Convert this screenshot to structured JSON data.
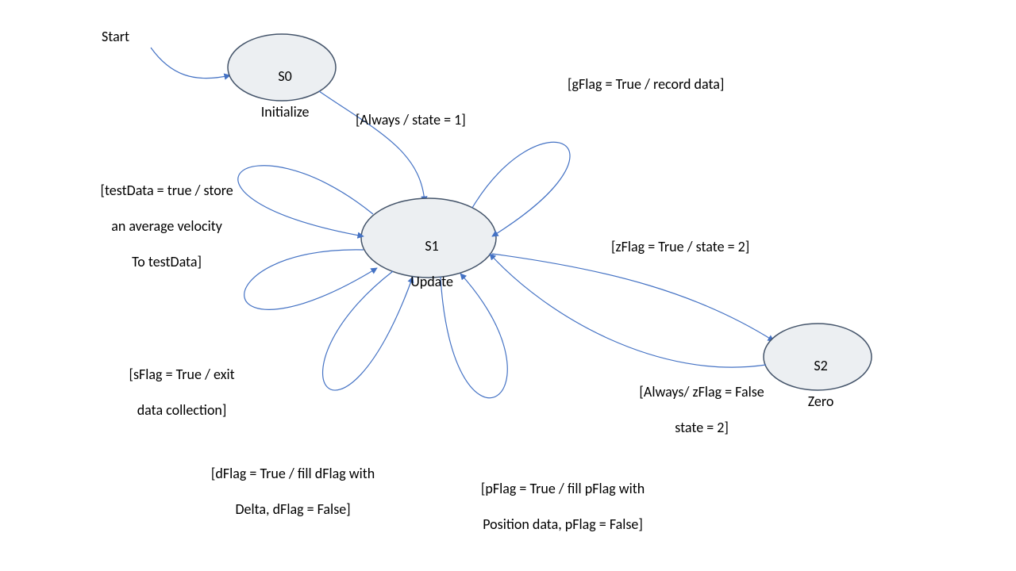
{
  "start_label": "Start",
  "states": {
    "s0": {
      "id": "S0",
      "name": "Initialize"
    },
    "s1": {
      "id": "S1",
      "name": "Update"
    },
    "s2": {
      "id": "S2",
      "name": "Zero"
    }
  },
  "transitions": {
    "s0_to_s1": "[Always / state = 1]",
    "s1_self_gflag": "[gFlag = True / record data]",
    "s1_self_testdata_l1": "[testData = true / store",
    "s1_self_testdata_l2": "an average velocity",
    "s1_self_testdata_l3": "To testData]",
    "s1_self_sflag_l1": "[sFlag = True / exit",
    "s1_self_sflag_l2": "data collection]",
    "s1_self_dflag_l1": "[dFlag = True / fill dFlag with",
    "s1_self_dflag_l2": "Delta, dFlag = False]",
    "s1_self_pflag_l1": "[pFlag = True / fill pFlag with",
    "s1_self_pflag_l2": "Position data, pFlag = False]",
    "s1_to_s2": "[zFlag = True / state = 2]",
    "s2_to_s1_l1": "[Always/ zFlag = False",
    "s2_to_s1_l2": "state = 2]"
  }
}
